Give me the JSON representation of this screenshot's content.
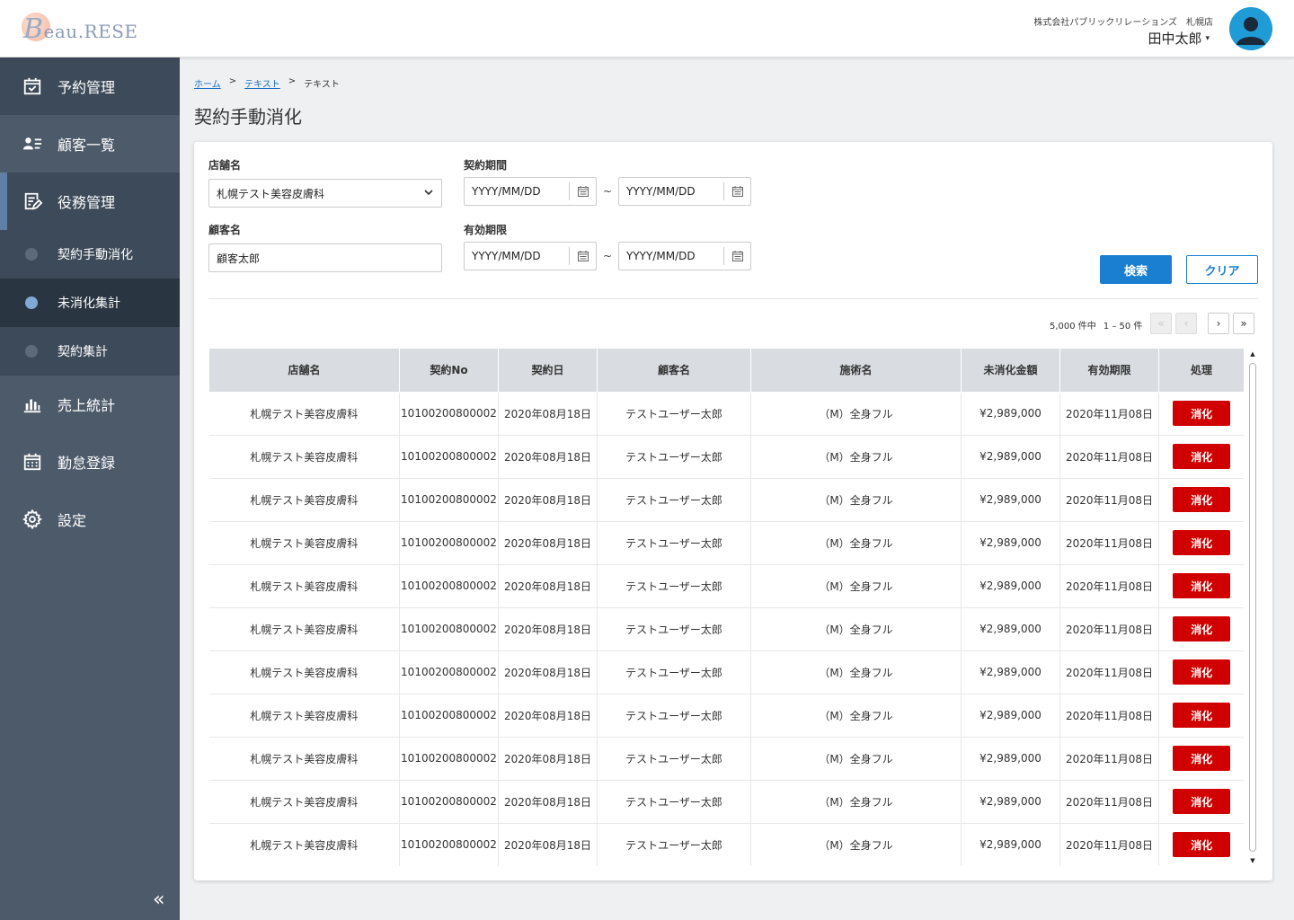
{
  "header": {
    "logo_big": "B",
    "logo_rest": "eau.RESE",
    "company": "株式会社パブリックリレーションズ　札幌店",
    "user_name": "田中太郎",
    "caret": "▾"
  },
  "sidebar": {
    "items": [
      {
        "label": "予約管理",
        "icon": "calendar-check-icon"
      },
      {
        "label": "顧客一覧",
        "icon": "user-list-icon"
      },
      {
        "label": "役務管理",
        "icon": "contract-edit-icon"
      }
    ],
    "sub_items": [
      {
        "label": "契約手動消化"
      },
      {
        "label": "未消化集計"
      },
      {
        "label": "契約集計"
      }
    ],
    "bottom_items": [
      {
        "label": "売上統計",
        "icon": "bar-chart-icon"
      },
      {
        "label": "勤怠登録",
        "icon": "calendar-grid-icon"
      },
      {
        "label": "設定",
        "icon": "gear-icon"
      }
    ],
    "collapse": "«"
  },
  "breadcrumb": {
    "home": "ホーム",
    "sep": ">",
    "level1": "テキスト",
    "current": "テキスト"
  },
  "page": {
    "title": "契約手動消化"
  },
  "filters": {
    "store_label": "店舗名",
    "store_value": "札幌テスト美容皮膚科",
    "customer_label": "顧客名",
    "customer_value": "顧客太郎",
    "contract_period_label": "契約期間",
    "valid_period_label": "有効期限",
    "date_placeholder": "YYYY/MM/DD",
    "tilde": "~",
    "search_button": "検索",
    "clear_button": "クリア"
  },
  "pager": {
    "total": "5,000 件中",
    "range": "1 – 50 件",
    "first": "«",
    "prev": "‹",
    "next": "›",
    "last": "»"
  },
  "table": {
    "columns": [
      "店舗名",
      "契約No",
      "契約日",
      "顧客名",
      "施術名",
      "未消化金額",
      "有効期限",
      "処理"
    ],
    "rows": [
      {
        "store": "札幌テスト美容皮膚科",
        "no": "10100200800002",
        "date": "2020年08月18日",
        "customer": "テストユーザー太郎",
        "treatment": "（M）全身フル",
        "amount": "¥2,989,000",
        "expiry": "2020年11月08日",
        "action": "消化"
      },
      {
        "store": "札幌テスト美容皮膚科",
        "no": "10100200800002",
        "date": "2020年08月18日",
        "customer": "テストユーザー太郎",
        "treatment": "（M）全身フル",
        "amount": "¥2,989,000",
        "expiry": "2020年11月08日",
        "action": "消化"
      },
      {
        "store": "札幌テスト美容皮膚科",
        "no": "10100200800002",
        "date": "2020年08月18日",
        "customer": "テストユーザー太郎",
        "treatment": "（M）全身フル",
        "amount": "¥2,989,000",
        "expiry": "2020年11月08日",
        "action": "消化"
      },
      {
        "store": "札幌テスト美容皮膚科",
        "no": "10100200800002",
        "date": "2020年08月18日",
        "customer": "テストユーザー太郎",
        "treatment": "（M）全身フル",
        "amount": "¥2,989,000",
        "expiry": "2020年11月08日",
        "action": "消化"
      },
      {
        "store": "札幌テスト美容皮膚科",
        "no": "10100200800002",
        "date": "2020年08月18日",
        "customer": "テストユーザー太郎",
        "treatment": "（M）全身フル",
        "amount": "¥2,989,000",
        "expiry": "2020年11月08日",
        "action": "消化"
      },
      {
        "store": "札幌テスト美容皮膚科",
        "no": "10100200800002",
        "date": "2020年08月18日",
        "customer": "テストユーザー太郎",
        "treatment": "（M）全身フル",
        "amount": "¥2,989,000",
        "expiry": "2020年11月08日",
        "action": "消化"
      },
      {
        "store": "札幌テスト美容皮膚科",
        "no": "10100200800002",
        "date": "2020年08月18日",
        "customer": "テストユーザー太郎",
        "treatment": "（M）全身フル",
        "amount": "¥2,989,000",
        "expiry": "2020年11月08日",
        "action": "消化"
      },
      {
        "store": "札幌テスト美容皮膚科",
        "no": "10100200800002",
        "date": "2020年08月18日",
        "customer": "テストユーザー太郎",
        "treatment": "（M）全身フル",
        "amount": "¥2,989,000",
        "expiry": "2020年11月08日",
        "action": "消化"
      },
      {
        "store": "札幌テスト美容皮膚科",
        "no": "10100200800002",
        "date": "2020年08月18日",
        "customer": "テストユーザー太郎",
        "treatment": "（M）全身フル",
        "amount": "¥2,989,000",
        "expiry": "2020年11月08日",
        "action": "消化"
      },
      {
        "store": "札幌テスト美容皮膚科",
        "no": "10100200800002",
        "date": "2020年08月18日",
        "customer": "テストユーザー太郎",
        "treatment": "（M）全身フル",
        "amount": "¥2,989,000",
        "expiry": "2020年11月08日",
        "action": "消化"
      },
      {
        "store": "札幌テスト美容皮膚科",
        "no": "10100200800002",
        "date": "2020年08月18日",
        "customer": "テストユーザー太郎",
        "treatment": "（M）全身フル",
        "amount": "¥2,989,000",
        "expiry": "2020年11月08日",
        "action": "消化"
      }
    ]
  },
  "colors": {
    "sidebar_bg": "#4c5a6a",
    "sidebar_active": "#2a3542",
    "primary": "#1b7fd1",
    "danger": "#d10000",
    "avatar_bg": "#1f9bd6"
  }
}
